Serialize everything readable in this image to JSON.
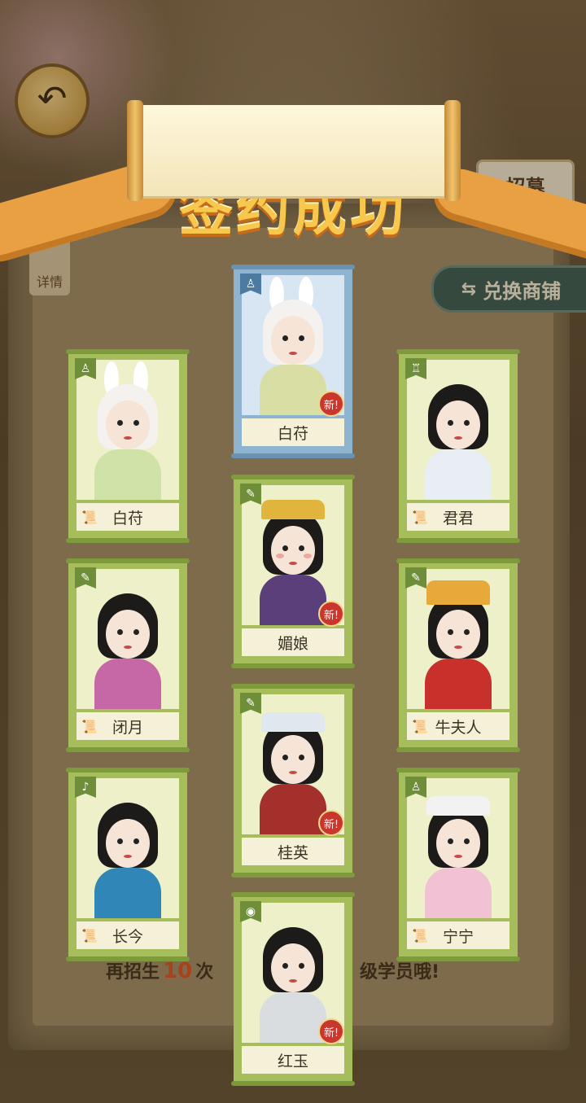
{
  "header": {
    "banner_text": "签约成功",
    "recruit_button": "招募",
    "exchange_button": "兑换商铺",
    "detail_tab": "详情"
  },
  "cards": [
    {
      "name": "白苻",
      "featured": true,
      "is_new": true,
      "new_label": "新!",
      "icon": "scroll-icon"
    },
    {
      "name": "白苻",
      "featured": false,
      "is_new": false,
      "icon": "scroll-icon"
    },
    {
      "name": "君君",
      "featured": false,
      "is_new": false,
      "icon": "scroll-icon"
    },
    {
      "name": "媚娘",
      "featured": false,
      "is_new": true,
      "new_label": "新!",
      "icon": "scroll-icon"
    },
    {
      "name": "闭月",
      "featured": false,
      "is_new": false,
      "icon": "scroll-icon"
    },
    {
      "name": "牛夫人",
      "featured": false,
      "is_new": false,
      "icon": "scroll-icon"
    },
    {
      "name": "桂英",
      "featured": false,
      "is_new": true,
      "new_label": "新!",
      "icon": "scroll-icon"
    },
    {
      "name": "长今",
      "featured": false,
      "is_new": false,
      "icon": "scroll-icon"
    },
    {
      "name": "宁宁",
      "featured": false,
      "is_new": false,
      "icon": "scroll-icon"
    },
    {
      "name": "红玉",
      "featured": false,
      "is_new": true,
      "new_label": "新!",
      "icon": "scroll-icon"
    }
  ],
  "footer": {
    "prefix": "再招生",
    "count": "10",
    "mid": "次",
    "suffix": "级学员哦!"
  },
  "colors": {
    "card_green": "#a6bd5c",
    "card_blue": "#8fb4cf",
    "banner_gold": "#f7c84b",
    "new_badge": "#c9362d"
  }
}
